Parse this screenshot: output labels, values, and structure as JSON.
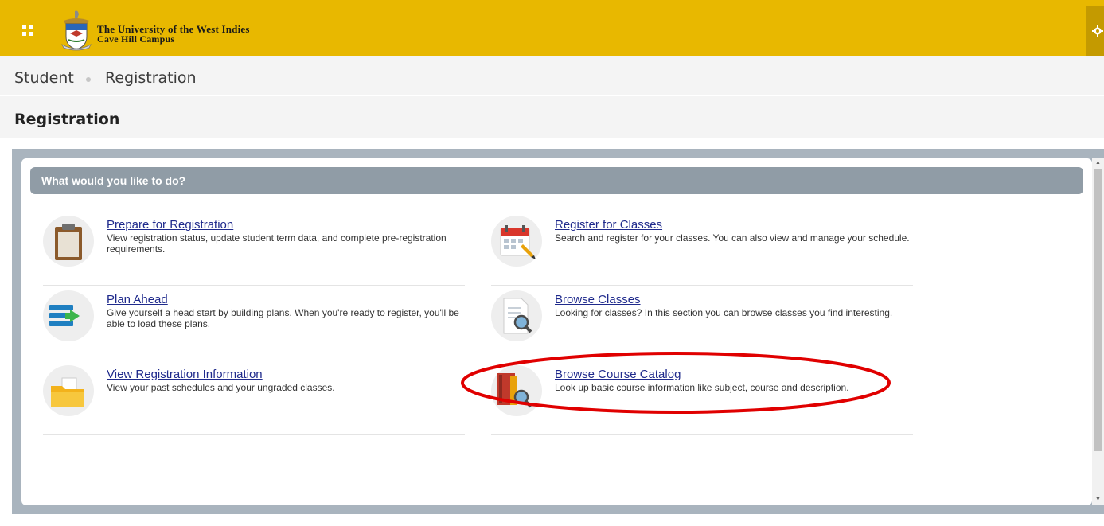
{
  "header": {
    "university_line1": "The University of the West Indies",
    "university_line2": "Cave Hill Campus",
    "brand_color": "#e8b800"
  },
  "breadcrumb": {
    "item1": "Student",
    "item2": "Registration"
  },
  "page_title": "Registration",
  "section": {
    "heading": "What would you like to do?"
  },
  "actions": [
    {
      "title": "Prepare for Registration",
      "description": "View registration status, update student term data, and complete pre-registration requirements.",
      "icon": "clipboard-icon"
    },
    {
      "title": "Register for Classes",
      "description": "Search and register for your classes. You can also view and manage your schedule.",
      "icon": "calendar-icon"
    },
    {
      "title": "Plan Ahead",
      "description": "Give yourself a head start by building plans. When you're ready to register, you'll be able to load these plans.",
      "icon": "plan-list-icon"
    },
    {
      "title": "Browse Classes",
      "description": "Looking for classes? In this section you can browse classes you find interesting.",
      "icon": "document-search-icon"
    },
    {
      "title": "View Registration Information",
      "description": "View your past schedules and your ungraded classes.",
      "icon": "folder-icon"
    },
    {
      "title": "Browse Course Catalog",
      "description": "Look up basic course information like subject, course and description.",
      "icon": "catalog-search-icon"
    }
  ],
  "annotation": {
    "highlight_color": "#e00000",
    "highlighted_action": "Browse Course Catalog"
  }
}
